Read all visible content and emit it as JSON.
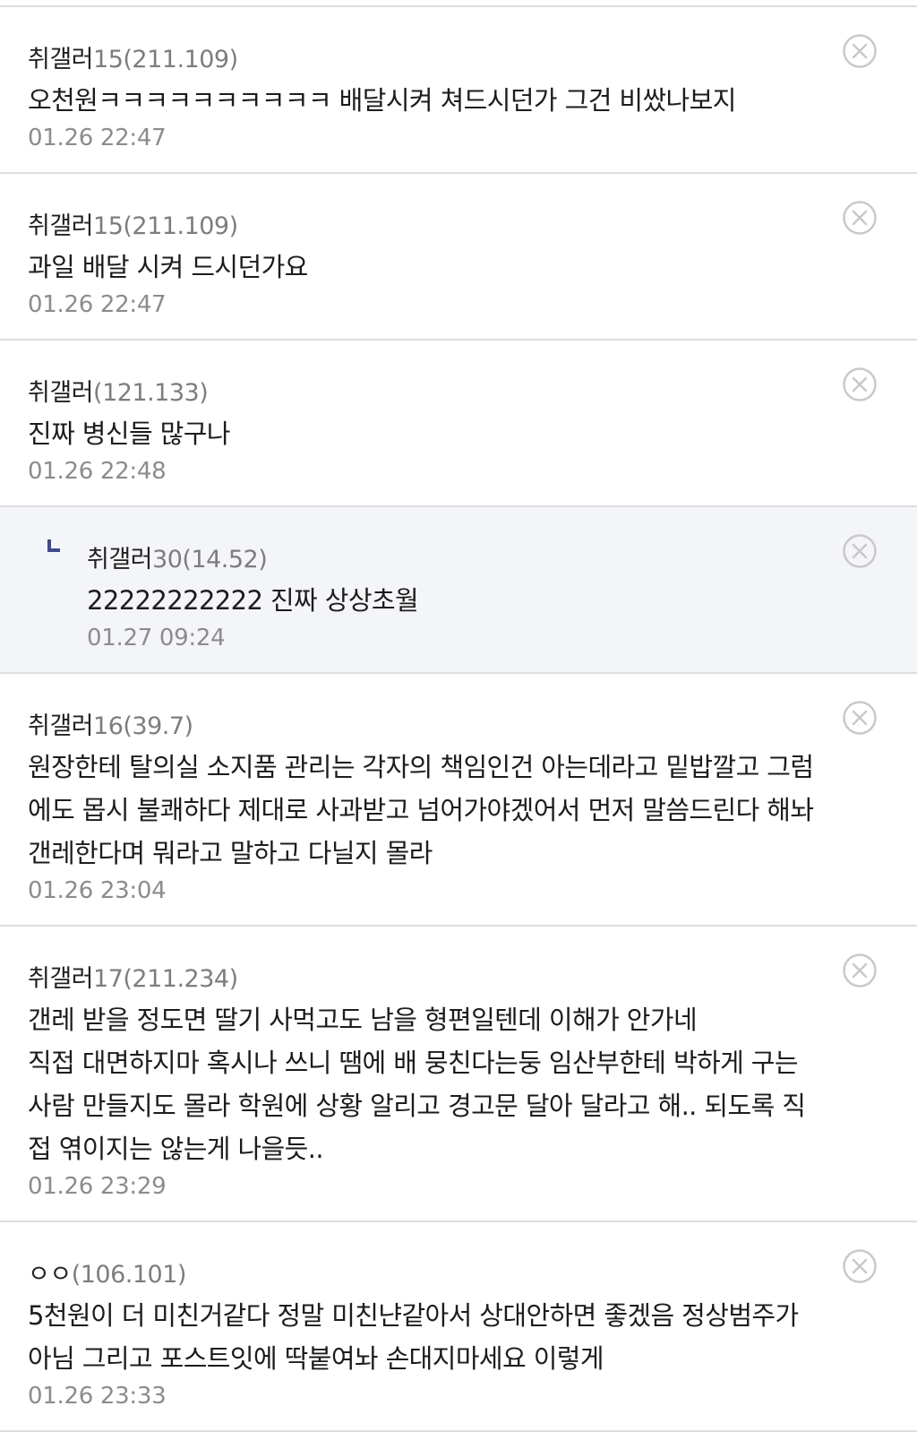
{
  "comments": [
    {
      "nick": "취갤러",
      "nick_num": "15",
      "ip": "(211.109)",
      "lines": [
        "오천원ㅋㅋㅋㅋㅋㅋㅋㅋㅋㅋ 배달시켜 쳐드시던가 그건 비쌌나보지"
      ],
      "date": "01.26 22:47",
      "is_reply": false
    },
    {
      "nick": "취갤러",
      "nick_num": "15",
      "ip": "(211.109)",
      "lines": [
        "과일 배달 시켜 드시던가요"
      ],
      "date": "01.26 22:47",
      "is_reply": false
    },
    {
      "nick": "취갤러",
      "nick_num": "",
      "ip": "(121.133)",
      "lines": [
        "진짜 병신들 많구나"
      ],
      "date": "01.26 22:48",
      "is_reply": false
    },
    {
      "nick": "취갤러",
      "nick_num": "30",
      "ip": "(14.52)",
      "lines": [
        "22222222222 진짜 상상초월"
      ],
      "date": "01.27 09:24",
      "is_reply": true
    },
    {
      "nick": "취갤러",
      "nick_num": "16",
      "ip": "(39.7)",
      "lines": [
        "원장한테 탈의실 소지품 관리는 각자의 책임인건 아는데라고 밑밥깔고 그럼",
        "에도 몹시 불쾌하다 제대로 사과받고 넘어가야겠어서 먼저 말씀드린다 해놔",
        "갠레한다며 뭐라고 말하고 다닐지 몰라"
      ],
      "date": "01.26 23:04",
      "is_reply": false
    },
    {
      "nick": "취갤러",
      "nick_num": "17",
      "ip": "(211.234)",
      "lines": [
        "갠레 받을 정도면 딸기 사먹고도 남을 형편일텐데 이해가 안가네",
        "직접 대면하지마 혹시나 쓰니 땜에 배 뭉친다는둥 임산부한테 박하게 구는",
        "사람 만들지도 몰라 학원에 상황 알리고 경고문 달아 달라고 해.. 되도록 직",
        "접 엮이지는 않는게 나을듯.."
      ],
      "date": "01.26 23:29",
      "is_reply": false
    },
    {
      "nick": "ㅇㅇ",
      "nick_num": "",
      "ip": "(106.101)",
      "lines": [
        "5천원이 더 미친거같다 정말 미친냔같아서 상대안하면 좋겠음 정상범주가",
        "아님 그리고 포스트잇에 딱붙여놔 손대지마세요 이렇게"
      ],
      "date": "01.26 23:33",
      "is_reply": false
    }
  ],
  "icons": {
    "delete": "close-circle-icon",
    "reply": "reply-arrow-icon"
  },
  "colors": {
    "reply_marker": "#3f4a8a",
    "reply_bg": "#f4f5f8",
    "divider": "#dedede",
    "meta_gray": "#7d7d7d"
  }
}
